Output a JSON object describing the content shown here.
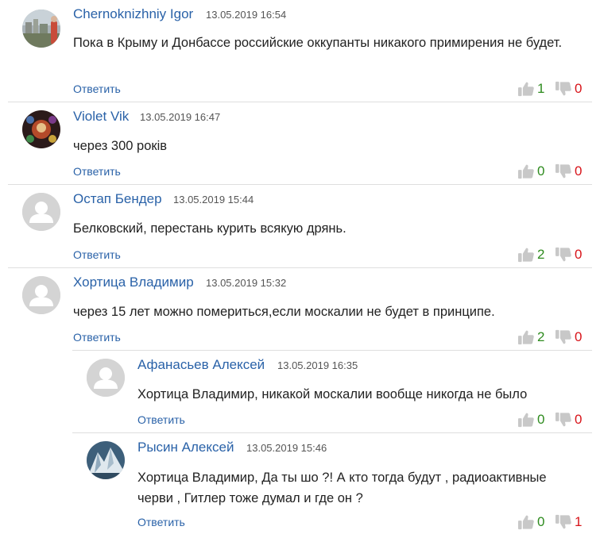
{
  "reply_label": "Ответить",
  "comments": [
    {
      "author": "Chernoknizhniy Igor",
      "date": "13.05.2019 16:54",
      "text": "Пока в Крыму и Донбассе российские оккупанты никакого примирения не будет.",
      "likes": "1",
      "dislikes": "0"
    },
    {
      "author": "Violet Vik",
      "date": "13.05.2019 16:47",
      "text": "через 300 років",
      "likes": "0",
      "dislikes": "0"
    },
    {
      "author": "Остап Бендер",
      "date": "13.05.2019 15:44",
      "text": "Белковский, перестань курить всякую дрянь.",
      "likes": "2",
      "dislikes": "0"
    },
    {
      "author": "Хортица Владимир",
      "date": "13.05.2019 15:32",
      "text": "через 15 лет можно помериться,если москалии не будет в принципе.",
      "likes": "2",
      "dislikes": "0"
    },
    {
      "author": "Афанасьев Алексей",
      "date": "13.05.2019 16:35",
      "text": "Хортица Владимир, никакой москалии вообще никогда не было",
      "likes": "0",
      "dislikes": "0"
    },
    {
      "author": "Рысин Алексей",
      "date": "13.05.2019 15:46",
      "text": "Хортица Владимир, Да ты шо ?! А кто тогда будут , радиоактивные черви , Гитлер тоже думал и где он ?",
      "likes": "0",
      "dislikes": "1"
    }
  ],
  "colors": {
    "link": "#2a62a8",
    "likes": "#2e8b1e",
    "dislikes": "#d8141a",
    "icon": "#c8c8c8",
    "divider": "#dedede"
  }
}
